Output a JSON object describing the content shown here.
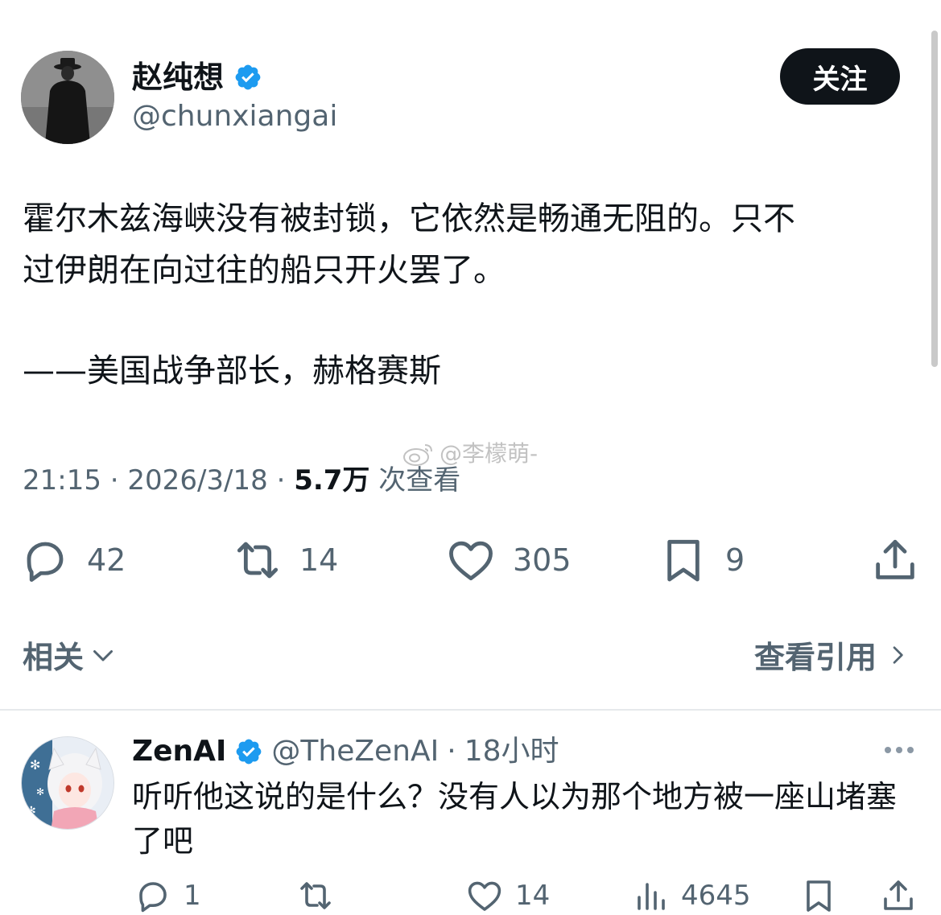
{
  "author": {
    "name": "赵纯想",
    "handle": "@chunxiangai",
    "follow_label": "关注"
  },
  "tweet": {
    "lines": [
      "霍尔木兹海峡没有被封锁，它依然是畅通无阻的。只不",
      "过伊朗在向过往的船只开火罢了。",
      "——美国战争部长，赫格赛斯"
    ]
  },
  "meta": {
    "time": "21:15",
    "sep1": "·",
    "date": "2026/3/18",
    "sep2": "·",
    "views_count": "5.7万",
    "views_label": "次查看"
  },
  "watermark": {
    "text": "@李檬萌-"
  },
  "actions": {
    "replies": "42",
    "retweets": "14",
    "likes": "305",
    "bookmarks": "9"
  },
  "related": {
    "label": "相关",
    "quotes_label": "查看引用"
  },
  "reply": {
    "name": "ZenAI",
    "handle": "@TheZenAI",
    "dot": "·",
    "time": "18小时",
    "lines": [
      "听听他这说的是什么？没有人以为那个地方被一座山堵塞",
      "了吧"
    ],
    "actions": {
      "replies": "1",
      "likes": "14",
      "views": "4645"
    }
  },
  "colors": {
    "text_primary": "#0f1419",
    "text_secondary": "#536471",
    "verified_blue": "#1d9bf0",
    "divider": "#e6e9ec"
  }
}
